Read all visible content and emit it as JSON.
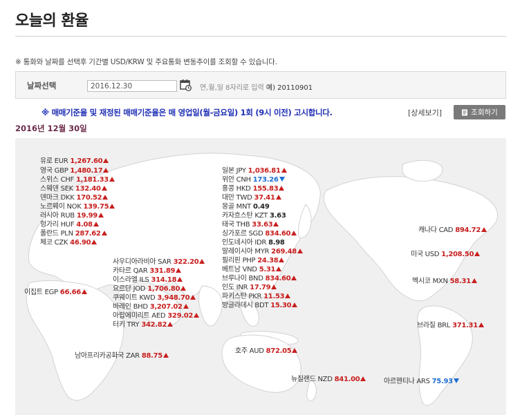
{
  "page": {
    "title": "오늘의 환율",
    "notice": "※ 통화와 날짜를 선택후 기간별 USD/KRW 및 주요통화 변동추이를 조회할 수 있습니다."
  },
  "date_select": {
    "label": "날짜선택",
    "value": "2016.12.30",
    "hint": "연,월,일 8자리로 입력",
    "hint_example": "예) 20110901"
  },
  "announcement": {
    "text": "※ 매매기준율 및 재정된 매매기준율은 매 영업일(월-금요일) 1회 (9시 이전) 고시합니다.",
    "detail_link": "[상세보기]",
    "lookup_button": "조회하기"
  },
  "rate_date": "2016년 12월 30일",
  "colors": {
    "up": "#c81e1e",
    "down": "#1c6ed4",
    "accent": "#1f2fb5",
    "date": "#6b2d4a"
  },
  "rates": [
    {
      "id": "eur",
      "name": "유로 EUR",
      "value": "1,267.60",
      "trend": "up"
    },
    {
      "id": "gbp",
      "name": "영국 GBP",
      "value": "1,480.17",
      "trend": "up"
    },
    {
      "id": "chf",
      "name": "스위스 CHF",
      "value": "1,181.33",
      "trend": "up"
    },
    {
      "id": "sek",
      "name": "스웨덴 SEK",
      "value": "132.40",
      "trend": "up"
    },
    {
      "id": "dkk",
      "name": "덴마크 DKK",
      "value": "170.52",
      "trend": "up"
    },
    {
      "id": "nok",
      "name": "노르웨이 NOK",
      "value": "139.75",
      "trend": "up"
    },
    {
      "id": "rub",
      "name": "러시아 RUB",
      "value": "19.99",
      "trend": "up"
    },
    {
      "id": "huf",
      "name": "헝가리 HUF",
      "value": "4.08",
      "trend": "up"
    },
    {
      "id": "pln",
      "name": "폴란드 PLN",
      "value": "287.62",
      "trend": "up"
    },
    {
      "id": "czk",
      "name": "체코 CZK",
      "value": "46.90",
      "trend": "up"
    },
    {
      "id": "egp",
      "name": "이집트 EGP",
      "value": "66.66",
      "trend": "up"
    },
    {
      "id": "sar",
      "name": "사우디아라비아 SAR",
      "value": "322.20",
      "trend": "up"
    },
    {
      "id": "qar",
      "name": "카타르 QAR",
      "value": "331.89",
      "trend": "up"
    },
    {
      "id": "ils",
      "name": "이스라엘 ILS",
      "value": "314.18",
      "trend": "up"
    },
    {
      "id": "jod",
      "name": "요르단 JOD",
      "value": "1,706.80",
      "trend": "up"
    },
    {
      "id": "kwd",
      "name": "쿠웨이트 KWD",
      "value": "3,948.70",
      "trend": "up"
    },
    {
      "id": "bhd",
      "name": "바레인 BHD",
      "value": "3,207.02",
      "trend": "up"
    },
    {
      "id": "aed",
      "name": "아랍에미리트 AED",
      "value": "329.02",
      "trend": "up"
    },
    {
      "id": "try",
      "name": "터키 TRY",
      "value": "342.82",
      "trend": "up"
    },
    {
      "id": "zar",
      "name": "남아프리카공화국 ZAR",
      "value": "88.75",
      "trend": "up"
    },
    {
      "id": "jpy",
      "name": "일본 JPY",
      "value": "1,036.81",
      "trend": "up"
    },
    {
      "id": "cnh",
      "name": "위안 CNH",
      "value": "173.26",
      "trend": "down"
    },
    {
      "id": "hkd",
      "name": "홍콩 HKD",
      "value": "155.83",
      "trend": "up"
    },
    {
      "id": "twd",
      "name": "대만 TWD",
      "value": "37.41",
      "trend": "up"
    },
    {
      "id": "mnt",
      "name": "몽골 MNT",
      "value": "0.49",
      "trend": "same"
    },
    {
      "id": "kzt",
      "name": "카자흐스탄 KZT",
      "value": "3.63",
      "trend": "same"
    },
    {
      "id": "thb",
      "name": "태국 THB",
      "value": "33.63",
      "trend": "up"
    },
    {
      "id": "sgd",
      "name": "싱가포르 SGD",
      "value": "834.60",
      "trend": "up"
    },
    {
      "id": "idr",
      "name": "인도네시아 IDR",
      "value": "8.98",
      "trend": "same"
    },
    {
      "id": "myr",
      "name": "말레이시아 MYR",
      "value": "269.48",
      "trend": "up"
    },
    {
      "id": "php",
      "name": "필리핀 PHP",
      "value": "24.38",
      "trend": "up"
    },
    {
      "id": "vnd",
      "name": "베트남 VND",
      "value": "5.31",
      "trend": "up"
    },
    {
      "id": "bnd",
      "name": "브루나이 BND",
      "value": "834.60",
      "trend": "up"
    },
    {
      "id": "inr",
      "name": "인도 INR",
      "value": "17.79",
      "trend": "up"
    },
    {
      "id": "pkr",
      "name": "파키스탄 PKR",
      "value": "11.53",
      "trend": "up"
    },
    {
      "id": "bdt",
      "name": "방글라데시 BDT",
      "value": "15.30",
      "trend": "up"
    },
    {
      "id": "aud",
      "name": "호주 AUD",
      "value": "872.05",
      "trend": "up"
    },
    {
      "id": "nzd",
      "name": "뉴질랜드 NZD",
      "value": "841.00",
      "trend": "up"
    },
    {
      "id": "cad",
      "name": "캐나다 CAD",
      "value": "894.72",
      "trend": "up"
    },
    {
      "id": "usd",
      "name": "미국 USD",
      "value": "1,208.50",
      "trend": "up"
    },
    {
      "id": "mxn",
      "name": "멕시코 MXN",
      "value": "58.31",
      "trend": "up"
    },
    {
      "id": "brl",
      "name": "브라질 BRL",
      "value": "371.31",
      "trend": "up"
    },
    {
      "id": "ars",
      "name": "아르헨티나 ARS",
      "value": "75.93",
      "trend": "down"
    }
  ]
}
